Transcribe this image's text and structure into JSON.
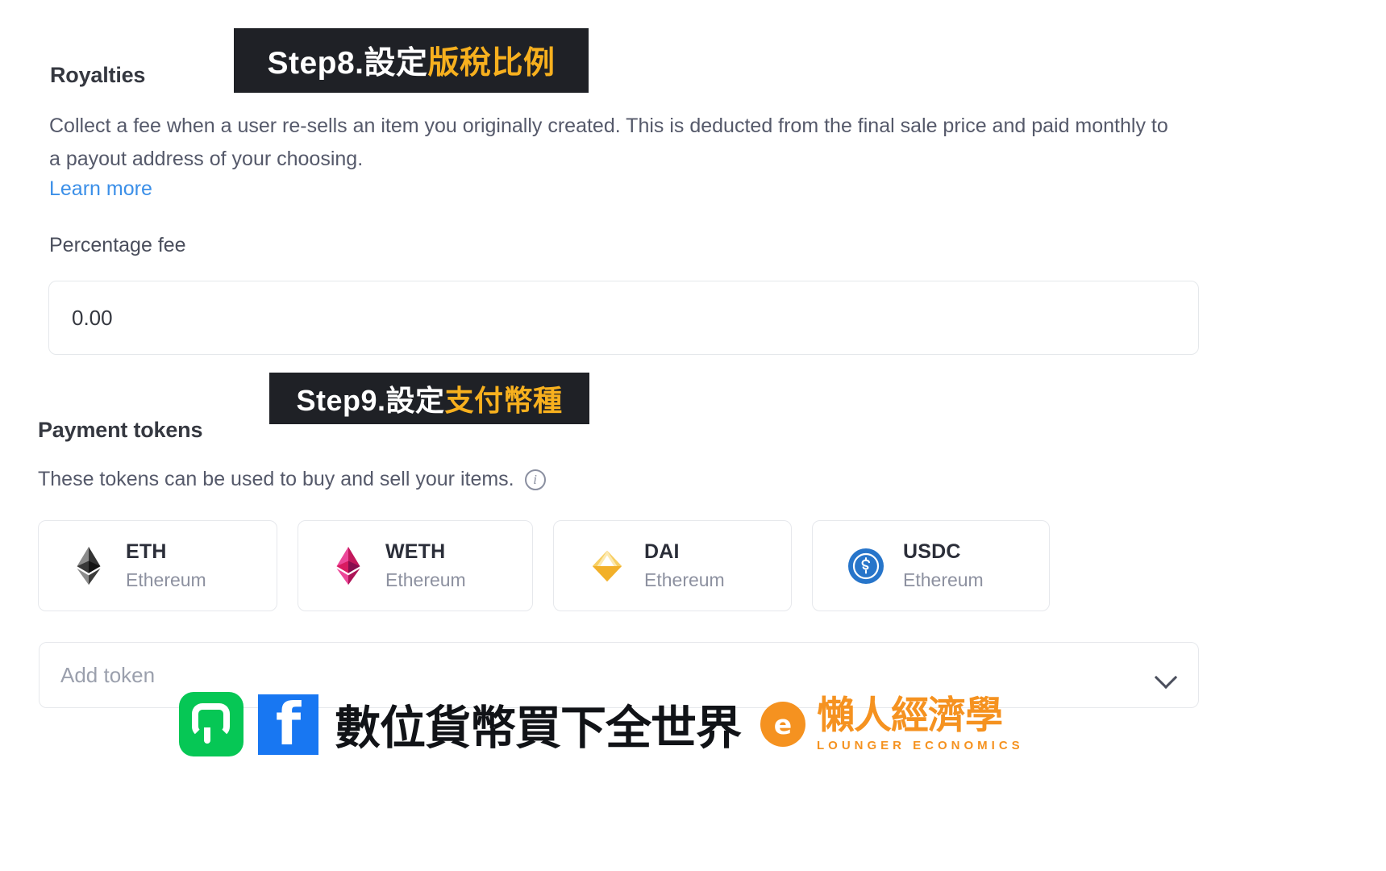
{
  "royalties": {
    "heading": "Royalties",
    "description": "Collect a fee when a user re-sells an item you originally created. This is deducted from the final sale price and paid monthly to a payout address of your choosing.",
    "learn_more": "Learn more",
    "percentage_label": "Percentage fee",
    "fee_value": "0.00",
    "fee_placeholder": "0.00"
  },
  "payment_tokens": {
    "heading": "Payment tokens",
    "description": "These tokens can be used to buy and sell your items.",
    "info_icon": "info-icon",
    "tokens": [
      {
        "symbol": "ETH",
        "chain": "Ethereum",
        "icon": "ethereum-diamond-icon",
        "color": "#3c3c3d"
      },
      {
        "symbol": "WETH",
        "chain": "Ethereum",
        "icon": "weth-diamond-icon",
        "color": "#e0246d"
      },
      {
        "symbol": "DAI",
        "chain": "Ethereum",
        "icon": "dai-diamond-icon",
        "color": "#f5ac37"
      },
      {
        "symbol": "USDC",
        "chain": "Ethereum",
        "icon": "usdc-circle-icon",
        "color": "#2775ca"
      }
    ],
    "add_token_placeholder": "Add token",
    "chevron_icon": "chevron-down-icon"
  },
  "annotations": {
    "step8": {
      "prefix": "Step8.設定",
      "highlight": "版稅比例"
    },
    "step9": {
      "prefix": "Step9.設定",
      "highlight": "支付幣種"
    },
    "colors": {
      "banner_bg": "#1f2126",
      "banner_text": "#ffffff",
      "banner_highlight": "#f7b01e"
    }
  },
  "watermark": {
    "line_icon": "line-app-icon",
    "facebook_icon": "facebook-icon",
    "facebook_glyph": "f",
    "title": "數位貨幣買下全世界",
    "logo_glyph": "e",
    "brand_cn": "懶人經濟學",
    "brand_en": "LOUNGER ECONOMICS"
  }
}
